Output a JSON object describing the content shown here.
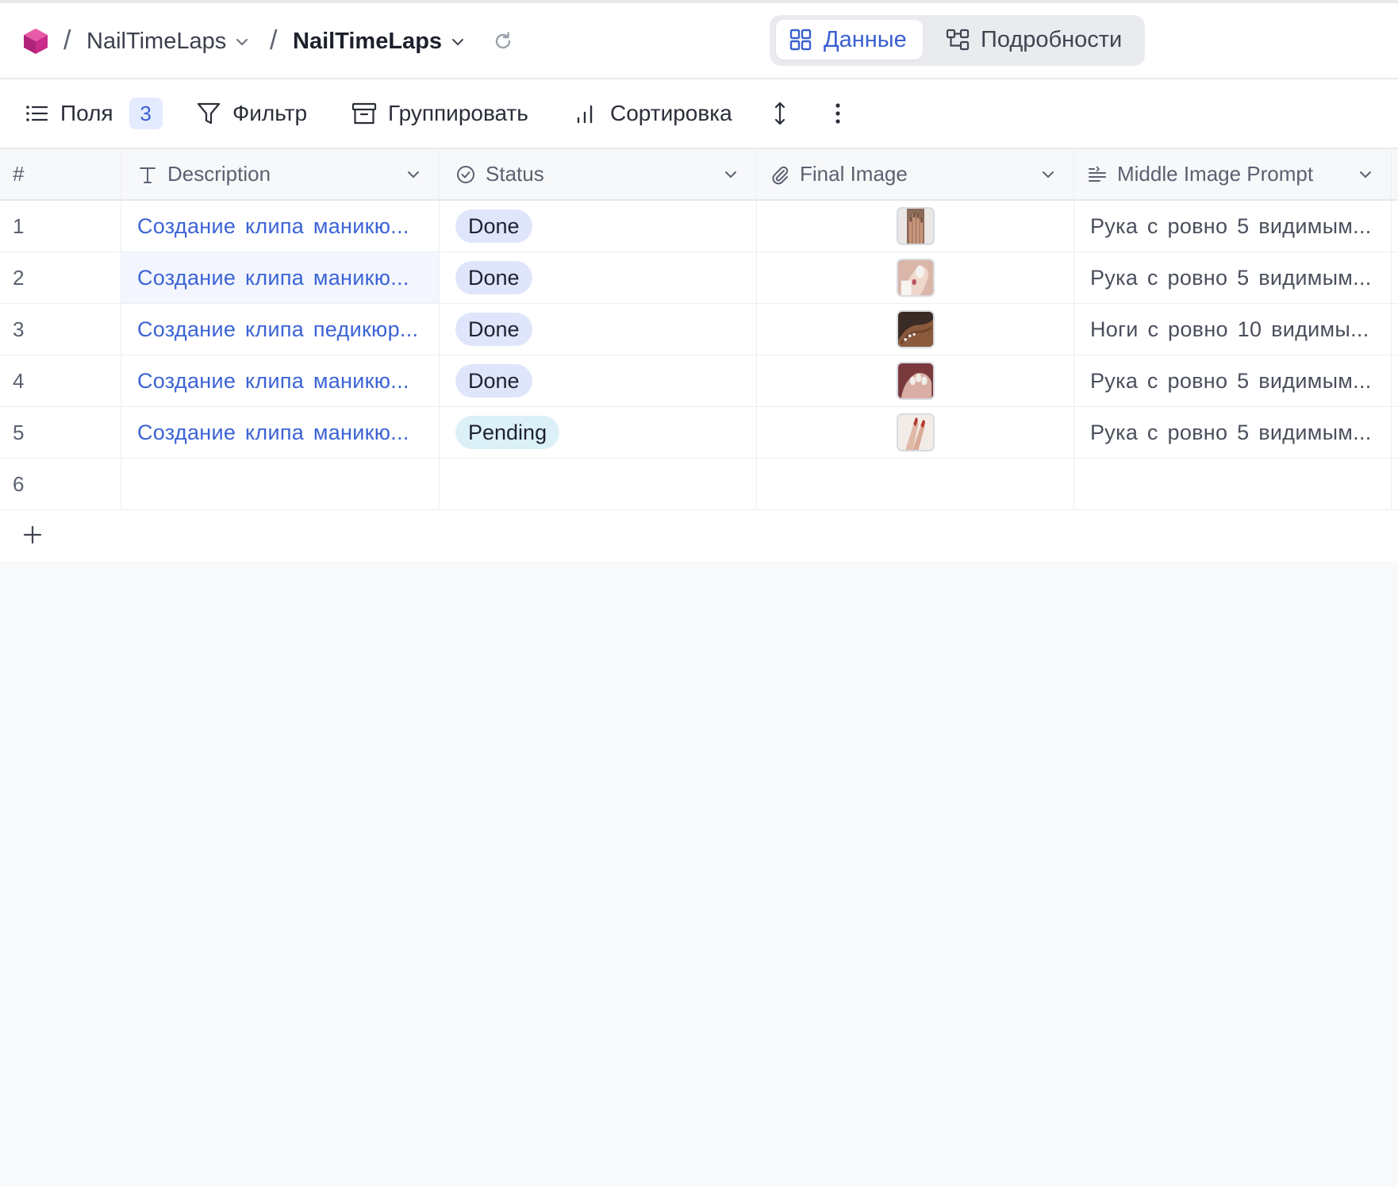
{
  "header": {
    "crumb_sep": "/",
    "crumb_project": "NailTimeLaps",
    "crumb_table": "NailTimeLaps",
    "tabs": [
      {
        "label": "Данные",
        "active": true
      },
      {
        "label": "Подробности",
        "active": false
      }
    ]
  },
  "toolbar": {
    "fields_label": "Поля",
    "fields_count": "3",
    "filter_label": "Фильтр",
    "group_label": "Группировать",
    "sort_label": "Сортировка"
  },
  "table": {
    "columns": {
      "num": "#",
      "description": "Description",
      "status": "Status",
      "final_image": "Final Image",
      "middle_prompt": "Middle Image Prompt"
    },
    "rows": [
      {
        "num": "1",
        "description": "Создание клипа маникю...",
        "status": "Done",
        "prompt": "Рука с ровно 5 видимым..."
      },
      {
        "num": "2",
        "description": "Создание клипа маникю...",
        "status": "Done",
        "prompt": "Рука с ровно 5 видимым..."
      },
      {
        "num": "3",
        "description": "Создание клипа педикюр...",
        "status": "Done",
        "prompt": "Ноги с ровно 10 видимы..."
      },
      {
        "num": "4",
        "description": "Создание клипа маникю...",
        "status": "Done",
        "prompt": "Рука с ровно 5 видимым..."
      },
      {
        "num": "5",
        "description": "Создание клипа маникю...",
        "status": "Pending",
        "prompt": "Рука с ровно 5 видимым..."
      },
      {
        "num": "6",
        "description": "",
        "status": "",
        "prompt": ""
      }
    ]
  },
  "colors": {
    "accent": "#3a5fd0",
    "link": "#3b63d6",
    "status_done": "#dfe6fb",
    "status_pending": "#dcf0f8",
    "logo": "#d6338f"
  },
  "icons": {
    "logo": "cube-logo-icon",
    "refresh": "refresh-icon",
    "data_tab": "grid-icon",
    "details_tab": "schema-icon",
    "fields": "list-icon",
    "filter": "filter-icon",
    "group": "archive-box-icon",
    "sort": "bar-chart-icon",
    "row_height": "vertical-arrows-icon",
    "more": "more-vertical-icon",
    "add_row": "plus-icon"
  }
}
